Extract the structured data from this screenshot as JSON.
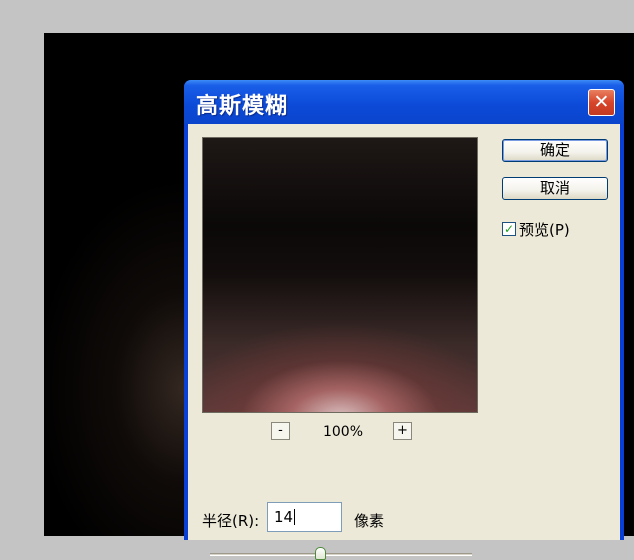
{
  "dialog": {
    "title": "高斯模糊",
    "close_glyph": "✕"
  },
  "buttons": {
    "ok": "确定",
    "cancel": "取消"
  },
  "preview_checkbox": {
    "label": "预览(P)",
    "checked": true,
    "check_glyph": "✓"
  },
  "zoom": {
    "minus": "-",
    "plus": "+",
    "level": "100%"
  },
  "radius": {
    "label": "半径(R):",
    "value": "14",
    "unit": "像素"
  },
  "slider": {
    "position_fraction": 0.42
  },
  "colors": {
    "titlebar": "#0c4bd8",
    "dialog_face": "#ece9d8",
    "close_button": "#d7452b",
    "check_mark": "#21a121"
  },
  "icons": {
    "close": "close-icon",
    "check": "checkmark-icon"
  }
}
